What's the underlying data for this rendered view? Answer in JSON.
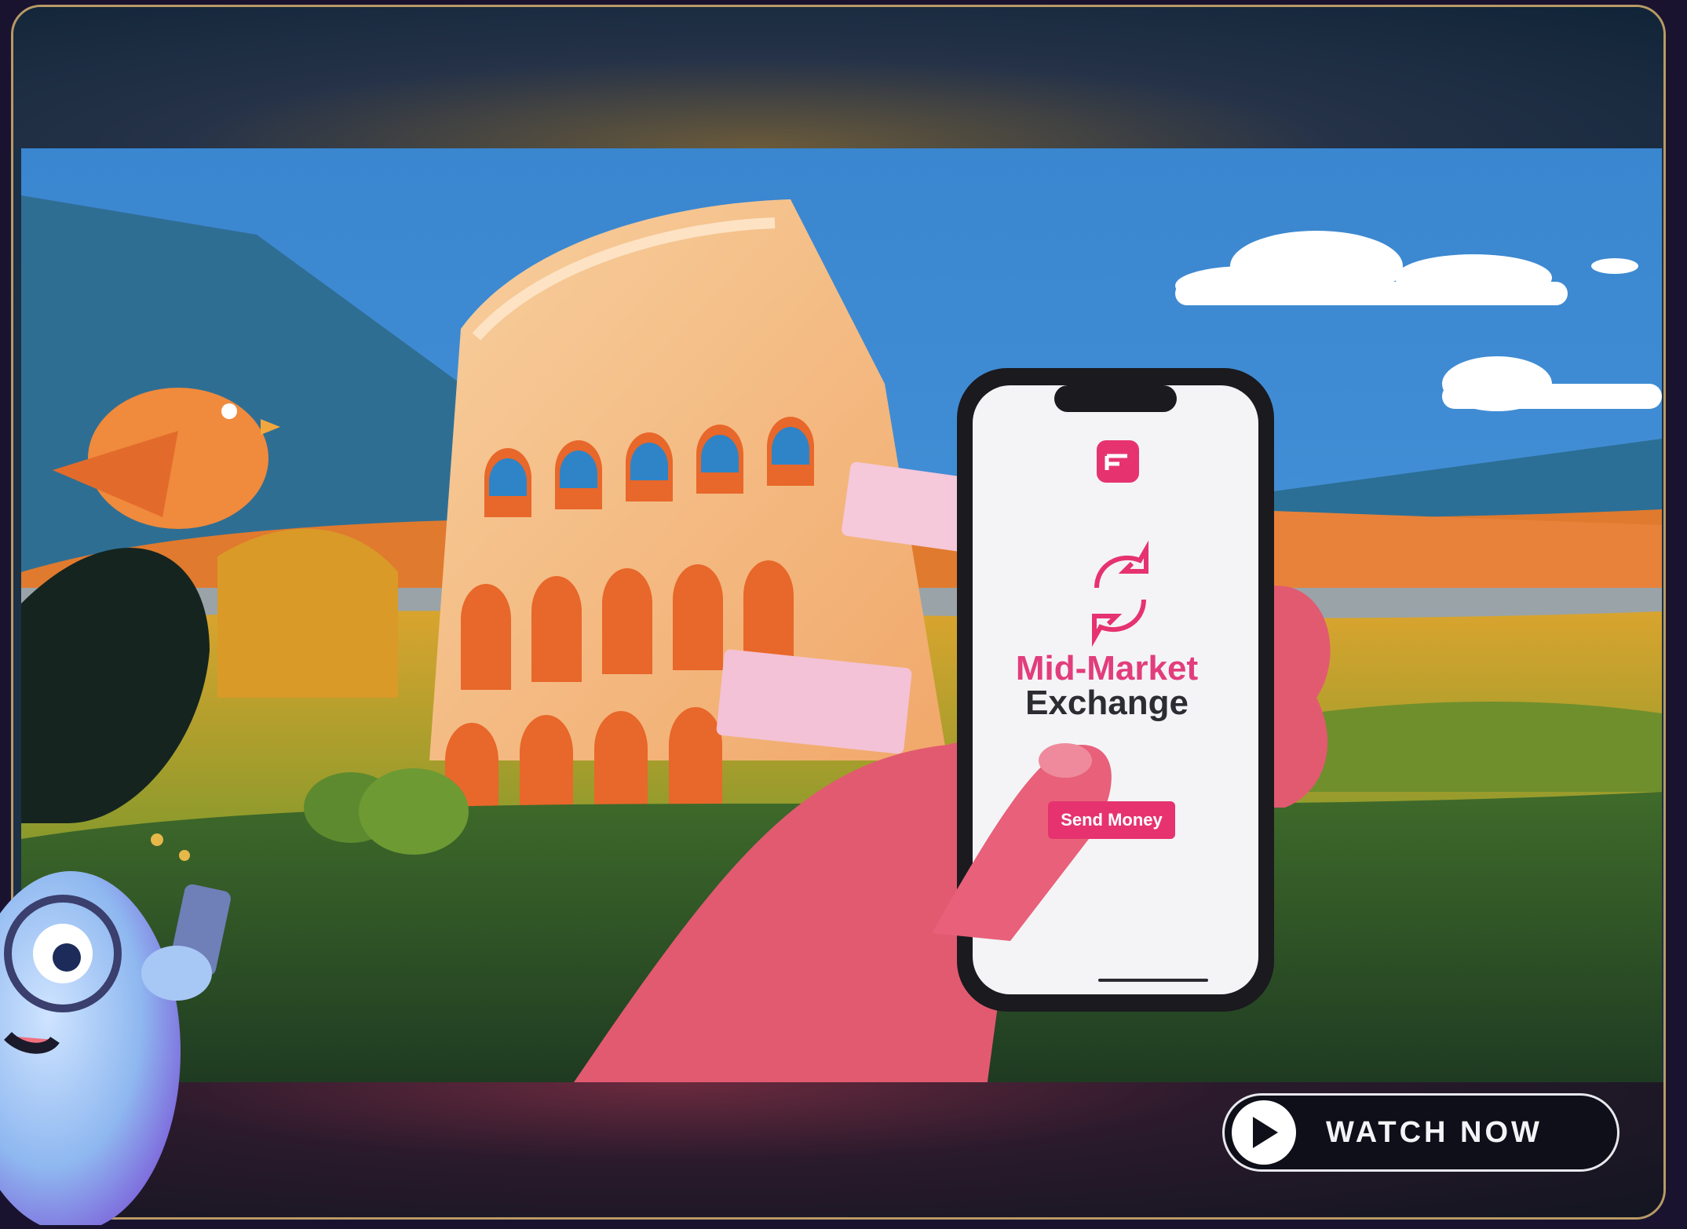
{
  "video": {
    "phone_screen": {
      "title_line1": "Mid-Market",
      "title_line2": "Exchange",
      "button_label": "Send Money",
      "app_icon": "brand-logo-icon",
      "exchange_icon": "exchange-arrows-icon"
    },
    "cta": {
      "label": "WATCH NOW",
      "icon": "play-icon"
    }
  },
  "colors": {
    "frame_border": "#b89a64",
    "brand_pink": "#e6336f",
    "cta_bg": "#0e0f18"
  }
}
